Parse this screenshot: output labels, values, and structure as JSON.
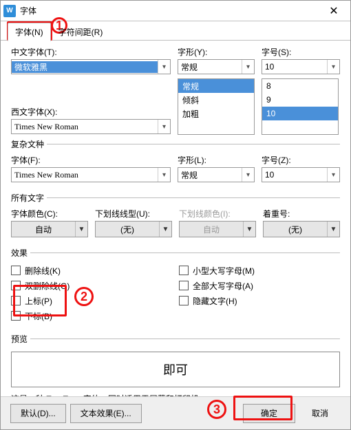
{
  "window": {
    "title": "字体",
    "close_glyph": "✕",
    "app_icon_text": "W"
  },
  "tabs": {
    "font": "字体(N)",
    "spacing": "字符间距(R)"
  },
  "section_cjk": {
    "font_label": "中文字体(T):",
    "font_value": "微软雅黑",
    "style_label": "字形(Y):",
    "style_value": "常规",
    "style_options": [
      "常规",
      "倾斜",
      "加粗"
    ],
    "size_label": "字号(S):",
    "size_value": "10",
    "size_options": [
      "8",
      "9",
      "10"
    ]
  },
  "section_latin": {
    "font_label": "西文字体(X):",
    "font_value": "Times New Roman"
  },
  "complex": {
    "legend": "复杂文种",
    "font_label": "字体(F):",
    "font_value": "Times New Roman",
    "style_label": "字形(L):",
    "style_value": "常规",
    "size_label": "字号(Z):",
    "size_value": "10"
  },
  "all_text": {
    "legend": "所有文字",
    "color_label": "字体颜色(C):",
    "color_value": "自动",
    "underline_label": "下划线线型(U):",
    "underline_value": "(无)",
    "ulcolor_label": "下划线颜色(I):",
    "ulcolor_value": "自动",
    "emphasis_label": "着重号:",
    "emphasis_value": "(无)"
  },
  "effects": {
    "legend": "效果",
    "strike": "删除线(K)",
    "dblstrike": "双删除线(G)",
    "superscript": "上标(P)",
    "subscript": "下标(B)",
    "smallcaps": "小型大写字母(M)",
    "allcaps": "全部大写字母(A)",
    "hidden": "隐藏文字(H)"
  },
  "preview": {
    "legend": "预览",
    "sample": "即可",
    "note": "这是一种 TrueType 字体，同时适用于屏幕和打印机。"
  },
  "footer": {
    "default": "默认(D)...",
    "text_effects": "文本效果(E)...",
    "ok": "确定",
    "cancel": "取消"
  },
  "annotations": {
    "n1": "1",
    "n2": "2",
    "n3": "3"
  }
}
